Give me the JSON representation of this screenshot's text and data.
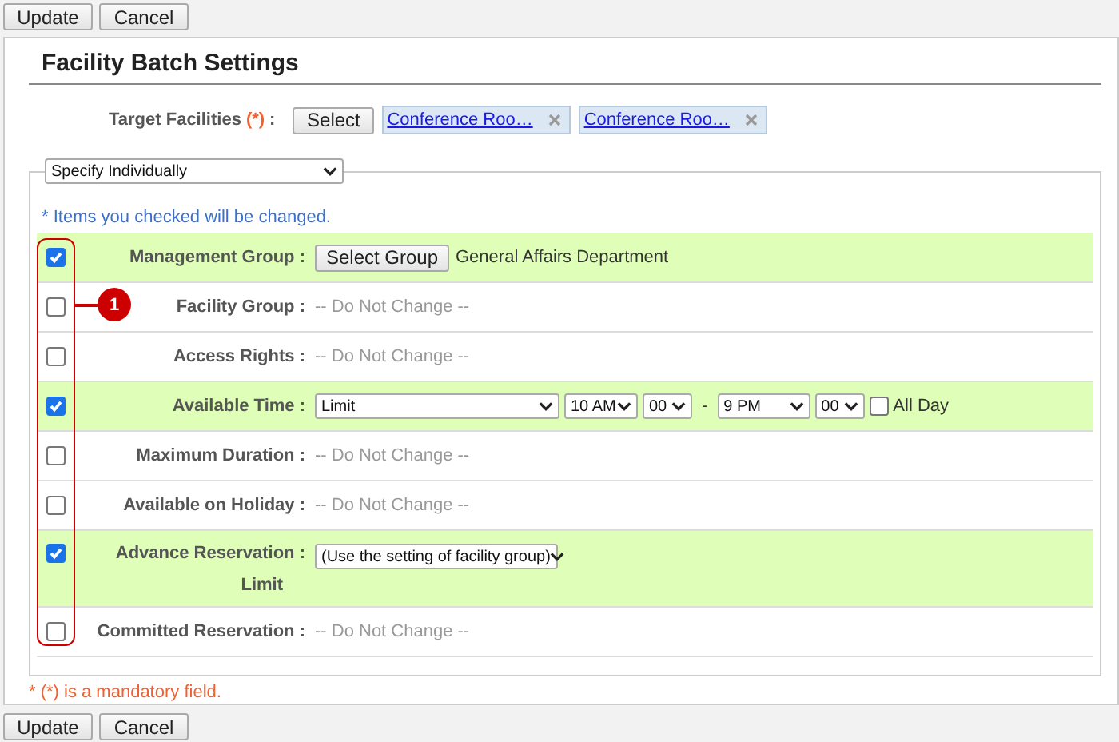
{
  "top_buttons": [
    "Update",
    "Cancel"
  ],
  "title": "Facility Batch Settings",
  "target": {
    "label": "Target Facilities",
    "required_mark": "(*)",
    "colon": ":",
    "button": "Select",
    "facilities": [
      "Conference Roo…",
      "Conference Roo…"
    ]
  },
  "mode_select": "Specify Individually",
  "note": "* Items you checked will be changed.",
  "callout": "1",
  "rows": [
    {
      "kind": "group",
      "label": "Management Group :",
      "checked": true,
      "button": "Select Group",
      "value": "General Affairs Department"
    },
    {
      "kind": "none",
      "label": "Facility Group :",
      "checked": false,
      "value": "-- Do Not Change --"
    },
    {
      "kind": "none",
      "label": "Access Rights :",
      "checked": false,
      "value": "-- Do Not Change --"
    },
    {
      "kind": "time",
      "label": "Available Time :",
      "checked": true,
      "mode": "Limit",
      "start_hour": "10 AM",
      "start_min": "00",
      "dash": "-",
      "end_hour": "9 PM",
      "end_min": "00",
      "all_day": {
        "label": "All Day",
        "checked": false
      }
    },
    {
      "kind": "none",
      "label": "Maximum Duration :",
      "checked": false,
      "value": "-- Do Not Change --"
    },
    {
      "kind": "none",
      "label": "Available on Holiday :",
      "checked": false,
      "value": "-- Do Not Change --"
    },
    {
      "kind": "select",
      "label": "Advance Reservation :",
      "label_2": "Limit",
      "checked": true,
      "value": "(Use the setting of facility group)"
    },
    {
      "kind": "none",
      "label": "Committed Reservation :",
      "checked": false,
      "value": "-- Do Not Change --"
    }
  ],
  "mandatory_note": "* (*) is a mandatory field.",
  "bottom_buttons": [
    "Update",
    "Cancel"
  ]
}
